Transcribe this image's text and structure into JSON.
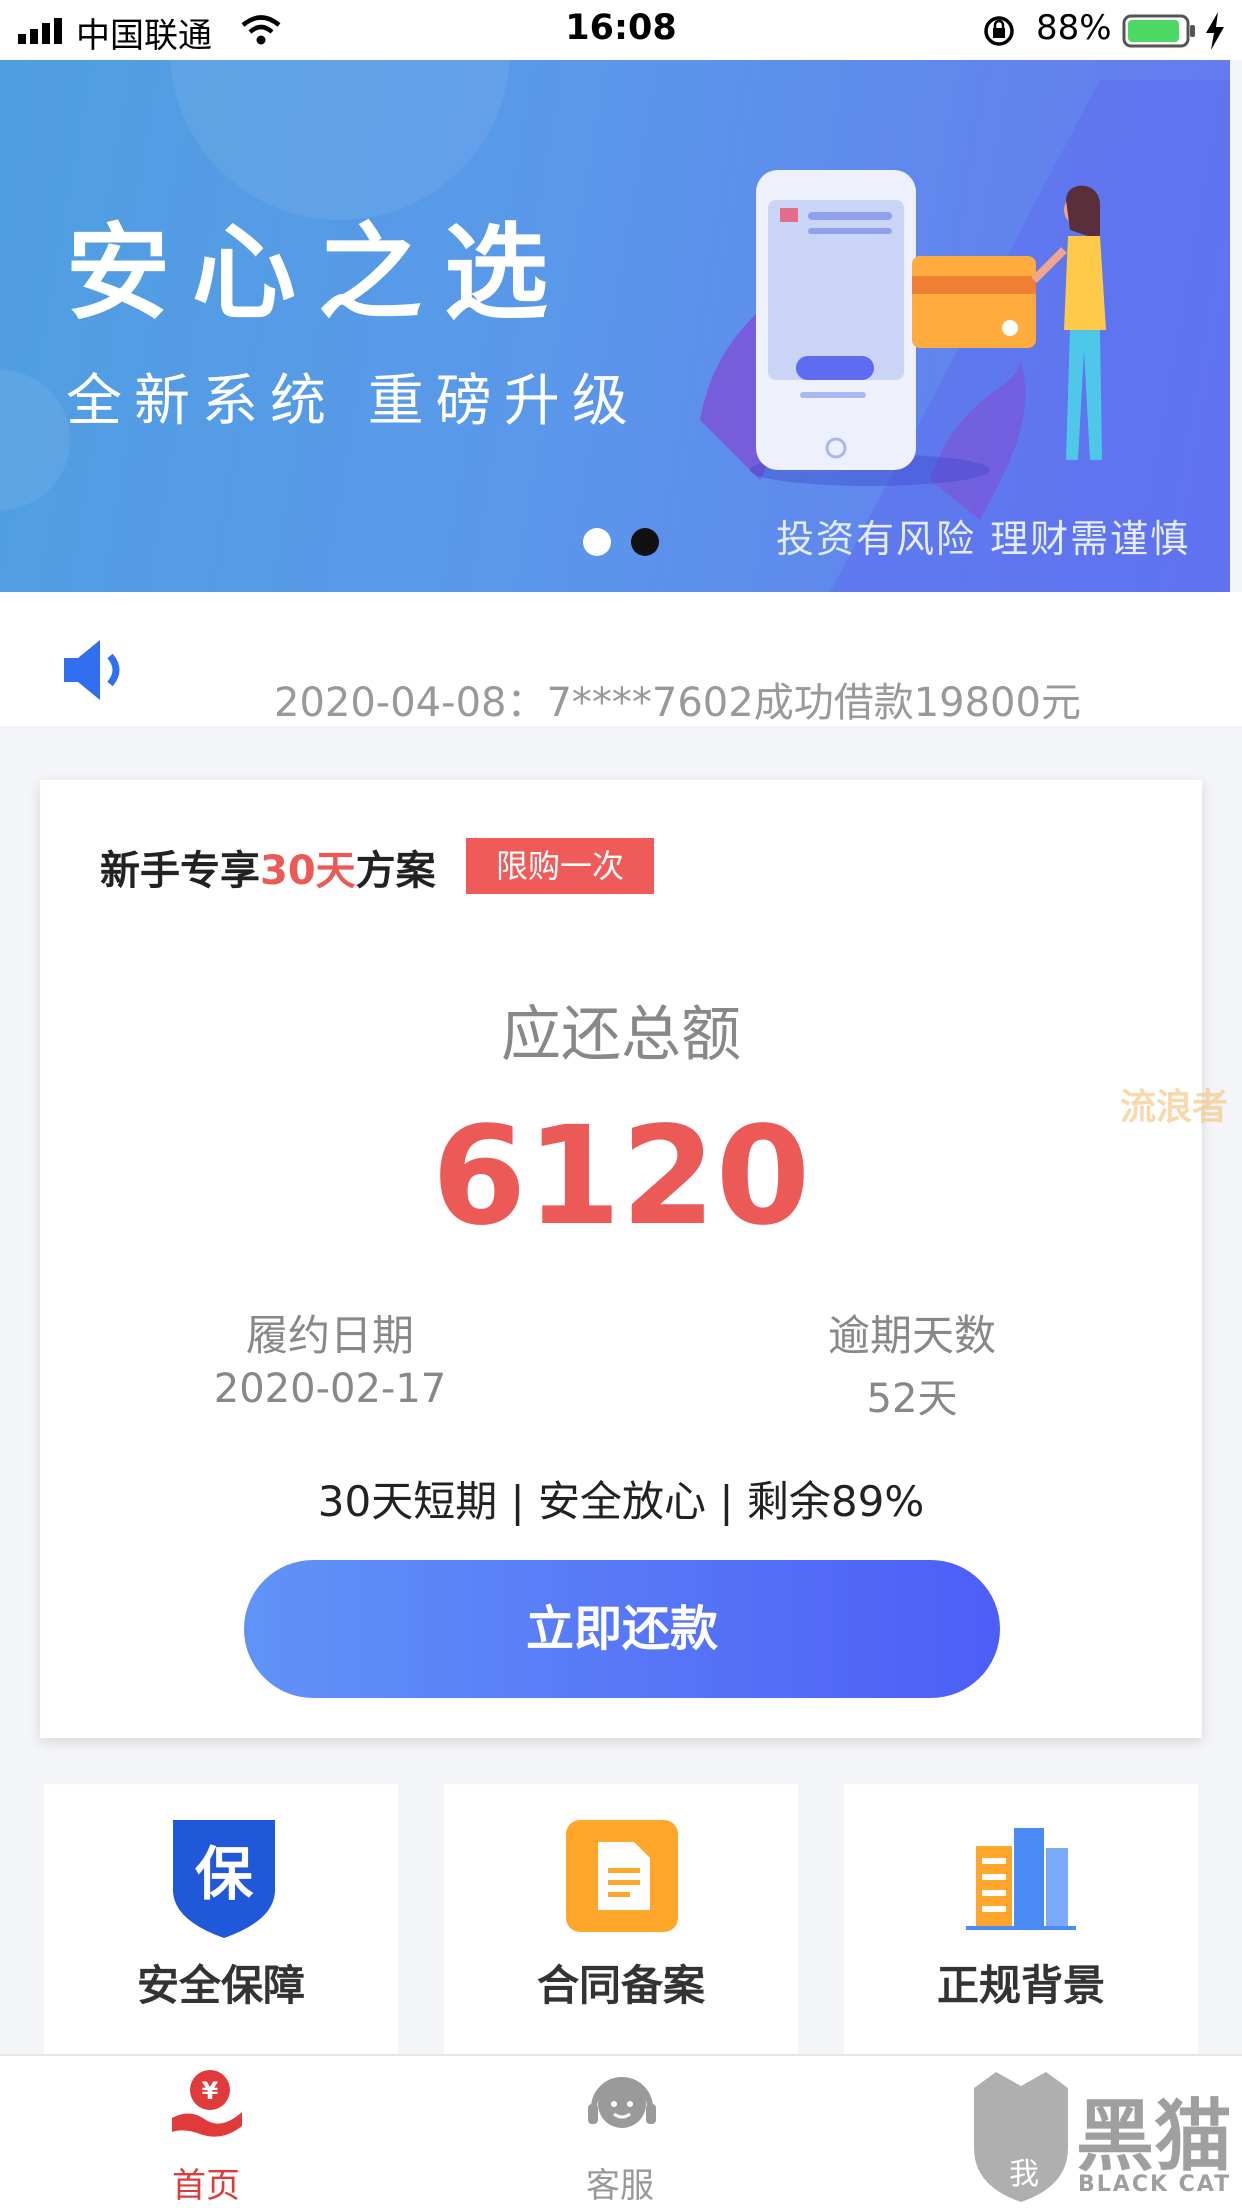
{
  "status_bar": {
    "carrier": "中国联通",
    "time": "16:08",
    "battery": "88%"
  },
  "banner": {
    "title": "安心之选",
    "subtitle": "全新系统 重磅升级",
    "risk_notice": "投资有风险 理财需谨慎",
    "active_slide": 2,
    "slide_count": 2
  },
  "notice": {
    "text": "2020-04-08：7****7602成功借款19800元"
  },
  "plan_card": {
    "title_prefix": "新手专享",
    "title_highlight": "30天",
    "title_suffix": "方案",
    "badge": "限购一次",
    "total_label": "应还总额",
    "total_value": "6120",
    "due_date_label": "履约日期",
    "due_date": "2020-02-17",
    "overdue_label": "逾期天数",
    "overdue_days": "52天",
    "tagline": "30天短期 | 安全放心 | 剩余89%",
    "repay_button": "立即还款",
    "accent_color": "#ec5a58"
  },
  "features": [
    {
      "label": "安全保障",
      "icon": "shield-icon",
      "icon_text": "保",
      "color": "#1f58d9"
    },
    {
      "label": "合同备案",
      "icon": "document-icon",
      "color": "#ffa62b"
    },
    {
      "label": "正规背景",
      "icon": "building-icon",
      "color": "#4a8bf5"
    }
  ],
  "tabs": [
    {
      "label": "首页",
      "icon": "home-yuan-icon",
      "active": true,
      "icon_text": "¥"
    },
    {
      "label": "客服",
      "icon": "customer-service-icon",
      "active": false
    }
  ],
  "watermarks": {
    "side": "流浪者",
    "brand_cn": "黑猫",
    "brand_en": "BLACK CAT",
    "brand_mark": "我"
  }
}
